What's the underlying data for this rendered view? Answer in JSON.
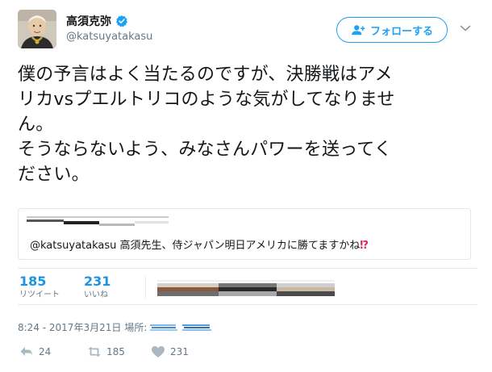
{
  "user": {
    "display_name": "高須克弥",
    "handle": "@katsuyatakasu",
    "verified": true
  },
  "follow_button": {
    "label": "フォローする"
  },
  "tweet": {
    "lines": [
      "僕の予言はよく当たるのですが、決勝戦はアメ",
      "リカvsプエルトリコのような気がしてなりませ",
      "ん。",
      "そうならないよう、みなさんパワーを送ってく",
      "ださい。"
    ]
  },
  "quote": {
    "text": "@katsuyatakasu 高須先生、侍ジャパン明日アメリカに勝てますかね",
    "emoji": "⁉"
  },
  "stats": {
    "retweets": {
      "count": "185",
      "label": "リツイート"
    },
    "likes": {
      "count": "231",
      "label": "いいね"
    }
  },
  "meta": {
    "timestamp": "8:24 - 2017年3月21日",
    "location_label": "場所:"
  },
  "actions": {
    "reply_count": "24",
    "retweet_count": "185",
    "like_count": "231"
  },
  "colors": {
    "accent": "#1da1f2",
    "stat_number": "#1b95e0",
    "muted": "#657786",
    "emoji_red": "#e0245e"
  },
  "icons": {
    "verified": "verified-badge-icon",
    "follow": "add-user-icon",
    "caret": "chevron-down-icon",
    "reply": "reply-icon",
    "retweet": "retweet-icon",
    "like": "heart-icon"
  }
}
